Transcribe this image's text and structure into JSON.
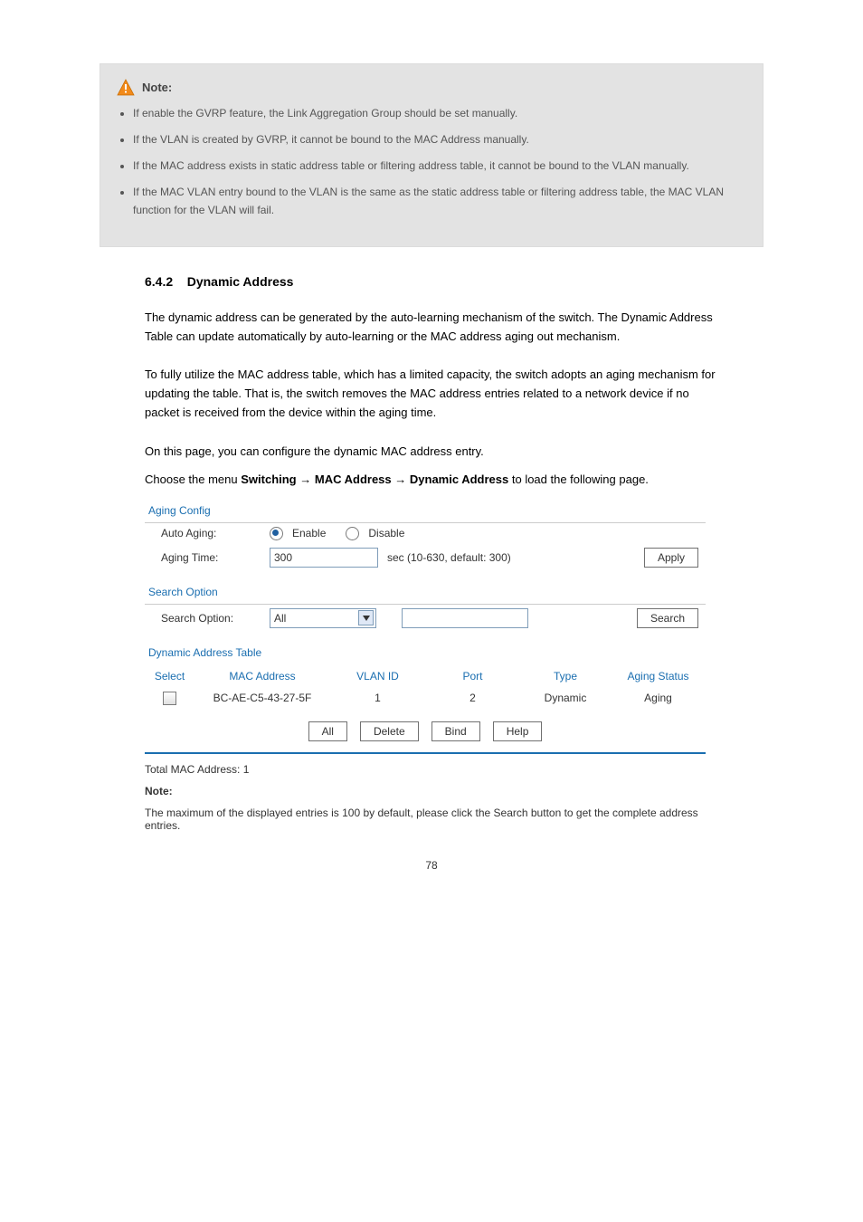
{
  "note": {
    "title": "Note:",
    "items": [
      "If enable the GVRP feature, the Link Aggregation Group should be set manually.",
      "If the VLAN is created by GVRP, it cannot be bound to the MAC Address manually.",
      "If the MAC address exists in static address table or filtering address table, it cannot be bound to the VLAN manually.",
      "If the MAC VLAN entry bound to the VLAN is the same as the static address table or filtering address table, the MAC VLAN function for the VLAN will fail."
    ]
  },
  "heading": {
    "number": "6.4.2",
    "title": "Dynamic Address"
  },
  "para1": "The dynamic address can be generated by the auto-learning mechanism of the switch. The Dynamic Address Table can update automatically by auto-learning or the MAC address aging out mechanism.",
  "para2": "To fully utilize the MAC address table, which has a limited capacity, the switch adopts an aging mechanism for updating the table. That is, the switch removes the MAC address entries related to a network device if no packet is received from the device within the aging time.",
  "para3": "On this page, you can configure the dynamic MAC address entry.",
  "menu_line": {
    "prefix": "Choose the menu ",
    "p1": "Switching",
    "arrow": "→",
    "p2": "MAC Address",
    "p3": "Dynamic Address",
    "suffix": " to load the following page."
  },
  "ui": {
    "aging_config": "Aging Config",
    "auto_aging_label": "Auto Aging:",
    "enable": "Enable",
    "disable": "Disable",
    "aging_time_label": "Aging Time:",
    "aging_time_value": "300",
    "aging_time_help": "sec (10-630, default: 300)",
    "apply": "Apply",
    "search_option": "Search Option",
    "search_option_label": "Search Option:",
    "search_option_value": "All",
    "search": "Search",
    "dyn_table": "Dynamic Address Table",
    "cols": {
      "select": "Select",
      "mac": "MAC Address",
      "vlan": "VLAN ID",
      "port": "Port",
      "type": "Type",
      "aging": "Aging Status"
    },
    "row1": {
      "mac": "BC-AE-C5-43-27-5F",
      "vlan": "1",
      "port": "2",
      "type": "Dynamic",
      "aging": "Aging"
    },
    "btn_all": "All",
    "btn_delete": "Delete",
    "btn_bind": "Bind",
    "btn_help": "Help",
    "total": "Total MAC Address: 1",
    "note_label": "Note:",
    "note_text": "The maximum of the displayed entries is 100 by default, please click the Search button to get the complete address entries."
  },
  "page_number": "78"
}
